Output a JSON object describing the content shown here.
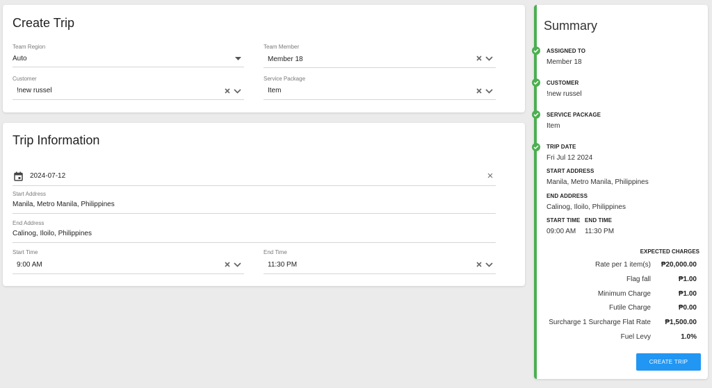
{
  "create_trip": {
    "title": "Create Trip",
    "team_region": {
      "label": "Team Region",
      "value": "Auto"
    },
    "team_member": {
      "label": "Team Member",
      "value": "Member 18"
    },
    "customer": {
      "label": "Customer",
      "value": "!new russel"
    },
    "service_package": {
      "label": "Service Package",
      "value": "Item"
    }
  },
  "trip_info": {
    "title": "Trip Information",
    "date": {
      "value": "2024-07-12"
    },
    "start_address": {
      "label": "Start Address",
      "value": "Manila, Metro Manila, Philippines"
    },
    "end_address": {
      "label": "End Address",
      "value": "Calinog, Iloilo, Philippines"
    },
    "start_time": {
      "label": "Start Time",
      "value": "9:00 AM"
    },
    "end_time": {
      "label": "End Time",
      "value": "11:30 PM"
    }
  },
  "summary": {
    "title": "Summary",
    "assigned_to": {
      "label": "ASSIGNED TO",
      "value": "Member 18"
    },
    "customer": {
      "label": "CUSTOMER",
      "value": "!new russel"
    },
    "service_package": {
      "label": "SERVICE PACKAGE",
      "value": "Item"
    },
    "trip_date": {
      "label": "TRIP DATE",
      "value": "Fri Jul 12 2024"
    },
    "start_address": {
      "label": "START ADDRESS",
      "value": "Manila, Metro Manila, Philippines"
    },
    "end_address": {
      "label": "END ADDRESS",
      "value": "Calinog, Iloilo, Philippines"
    },
    "start_time": {
      "label": "START TIME",
      "value": "09:00 AM"
    },
    "end_time": {
      "label": "END TIME",
      "value": "11:30 PM"
    },
    "charges_title": "EXPECTED CHARGES",
    "charges": [
      {
        "label": "Rate per 1 item(s)",
        "amount": "₱20,000.00"
      },
      {
        "label": "Flag fall",
        "amount": "₱1.00"
      },
      {
        "label": "Minimum Charge",
        "amount": "₱1.00"
      },
      {
        "label": "Futile Charge",
        "amount": "₱0.00"
      },
      {
        "label": "Surcharge 1 Surcharge Flat Rate",
        "amount": "₱1,500.00"
      },
      {
        "label": "Fuel Levy",
        "amount": "1.0%"
      }
    ],
    "create_button": "CREATE TRIP"
  },
  "colors": {
    "accent": "#2196f3",
    "success": "#4caf50"
  }
}
